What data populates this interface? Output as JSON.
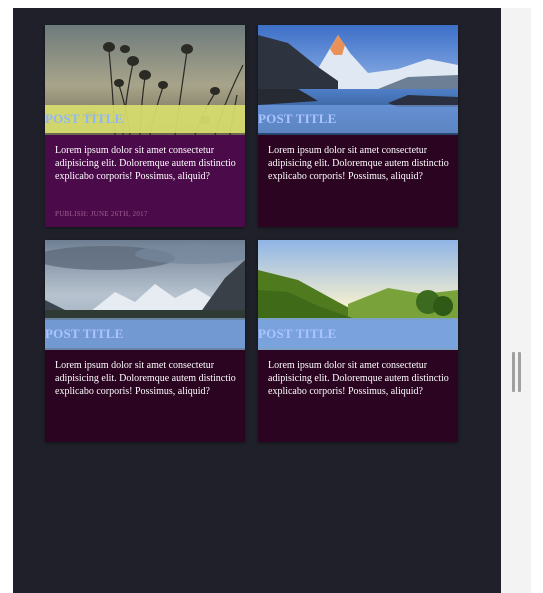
{
  "posts": [
    {
      "title": "POST TITLE",
      "excerpt": "Lorem ipsum dolor sit amet consectetur adipisicing elit. Doloremque autem distinctio explicabo corporis! Possimus, aliquid?",
      "date": "PUBLISH: JUNE 26TH, 2017",
      "image": "silhouette-flowers-sunset"
    },
    {
      "title": "POST TITLE",
      "excerpt": "Lorem ipsum dolor sit amet consectetur adipisicing elit. Doloremque autem distinctio explicabo corporis! Possimus, aliquid?",
      "image": "mountain-lake-reflection"
    },
    {
      "title": "POST TITLE",
      "excerpt": "Lorem ipsum dolor sit amet consectetur adipisicing elit. Doloremque autem distinctio explicabo corporis! Possimus, aliquid?",
      "image": "snowy-mountain-range"
    },
    {
      "title": "POST TITLE",
      "excerpt": "Lorem ipsum dolor sit amet consectetur adipisicing elit. Doloremque autem distinctio explicabo corporis! Possimus, aliquid?",
      "image": "green-hills-landscape"
    }
  ],
  "colors": {
    "page_background": "#1f2029",
    "card_background": "#2a0420",
    "active_card_background": "#4b0a4a",
    "title_bar": "#78a5eb",
    "active_title_bar": "#d7de6e",
    "title_text": "#a9c4ff",
    "date_text": "#a35f92"
  }
}
